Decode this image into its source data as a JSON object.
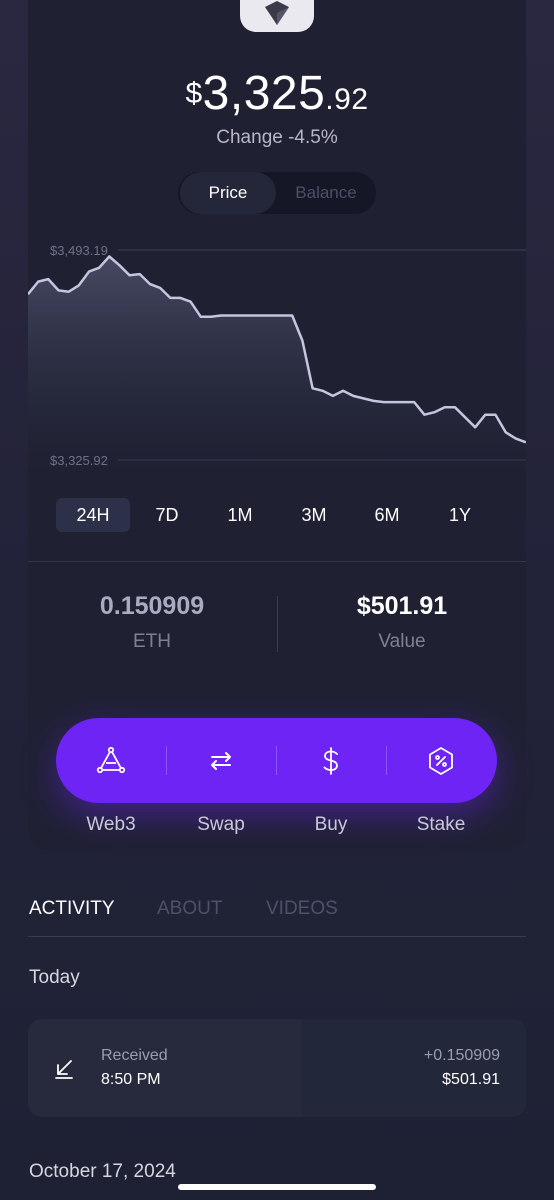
{
  "header": {
    "currency_symbol": "$",
    "price_whole": "3,325",
    "price_decimal": ".92",
    "change": "Change -4.5%"
  },
  "toggle": {
    "price_label": "Price",
    "balance_label": "Balance"
  },
  "chart_data": {
    "type": "area",
    "title": "",
    "y_max_label": "$3,493.19",
    "y_min_label": "$3,325.92",
    "ylim": [
      3325.92,
      3493.19
    ],
    "x": [
      0,
      1,
      2,
      3,
      4,
      5,
      6,
      7,
      8,
      9,
      10,
      11,
      12,
      13,
      14,
      15,
      16,
      17,
      18,
      19,
      20,
      21,
      22,
      23,
      24,
      25,
      26,
      27,
      28,
      29,
      30,
      31,
      32,
      33,
      34,
      35,
      36,
      37,
      38,
      39,
      40,
      41,
      42,
      43,
      44,
      45,
      46,
      47,
      48,
      49
    ],
    "values": [
      3458,
      3468,
      3470,
      3461,
      3460,
      3465,
      3476,
      3479,
      3488,
      3481,
      3473,
      3474,
      3466,
      3463,
      3455,
      3455,
      3452,
      3440,
      3440,
      3441,
      3441,
      3441,
      3441,
      3441,
      3441,
      3441,
      3441,
      3421,
      3383,
      3381,
      3377,
      3381,
      3377,
      3375,
      3373,
      3372,
      3372,
      3372,
      3372,
      3362,
      3364,
      3368,
      3368,
      3360,
      3352,
      3362,
      3362,
      3348,
      3343,
      3340
    ],
    "color": "#c4c6e0",
    "grid": true
  },
  "ranges": [
    "24H",
    "7D",
    "1M",
    "3M",
    "6M",
    "1Y"
  ],
  "selected_range": "24H",
  "stats": {
    "amount": "0.150909",
    "amount_label": "ETH",
    "value": "$501.91",
    "value_label": "Value"
  },
  "actions": [
    {
      "label": "Web3",
      "icon": "web3-icon"
    },
    {
      "label": "Swap",
      "icon": "swap-icon"
    },
    {
      "label": "Buy",
      "icon": "dollar-icon"
    },
    {
      "label": "Stake",
      "icon": "stake-icon"
    }
  ],
  "tabs": [
    "ACTIVITY",
    "ABOUT",
    "VIDEOS"
  ],
  "activity": {
    "today_label": "Today",
    "transaction": {
      "type": "Received",
      "time": "8:50 PM",
      "amount": "+0.150909",
      "value": "$501.91"
    },
    "next_date": "October 17, 2024"
  },
  "colors": {
    "accent": "#6e24f5",
    "background": "#1f2133",
    "card": "#262a3c"
  }
}
